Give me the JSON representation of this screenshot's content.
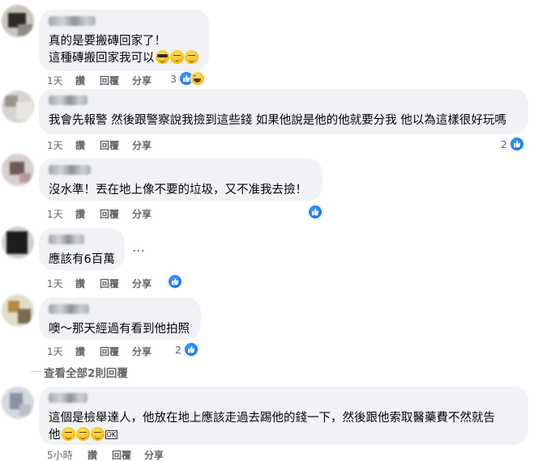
{
  "actions": {
    "like": "讚",
    "reply": "回覆",
    "share": "分享"
  },
  "comments": [
    {
      "text_line1": "真的是要搬磚回家了！",
      "text_line2": "這種磚搬回家我可以",
      "time": "1天",
      "reaction_count": "3",
      "emoji": [
        "smiling-face-with-sunglasses-emoji",
        "smirking-face-emoji",
        "grinning-face-emoji"
      ]
    },
    {
      "text": "我會先報警 然後跟警察說我撿到這些錢 如果他說是他的他就要分我 他以為這樣很好玩嗎",
      "time": "1天",
      "reaction_count": "2"
    },
    {
      "text": "沒水準！丟在地上像不要的垃圾，又不准我去撿！",
      "time": "1天",
      "reaction_count": ""
    },
    {
      "text": "應該有6百萬",
      "time": "1天",
      "reaction_count": "",
      "more": "…"
    },
    {
      "text": "噢～那天經過有看到他拍照",
      "time": "1天",
      "reaction_count": "2"
    },
    {
      "text_line1": "這個是檢舉達人，他放在地上應該走過去踢他的錢一下，然後跟他索取醫藥費不然就告",
      "text_line2": "他",
      "badge": "OK",
      "time": "5小時",
      "reaction_count": ""
    }
  ],
  "view_replies": "查看全部2則回覆",
  "colors": {
    "bubble": "#f0f2f5",
    "meta": "#65676b",
    "like_blue": "#1877f2"
  }
}
